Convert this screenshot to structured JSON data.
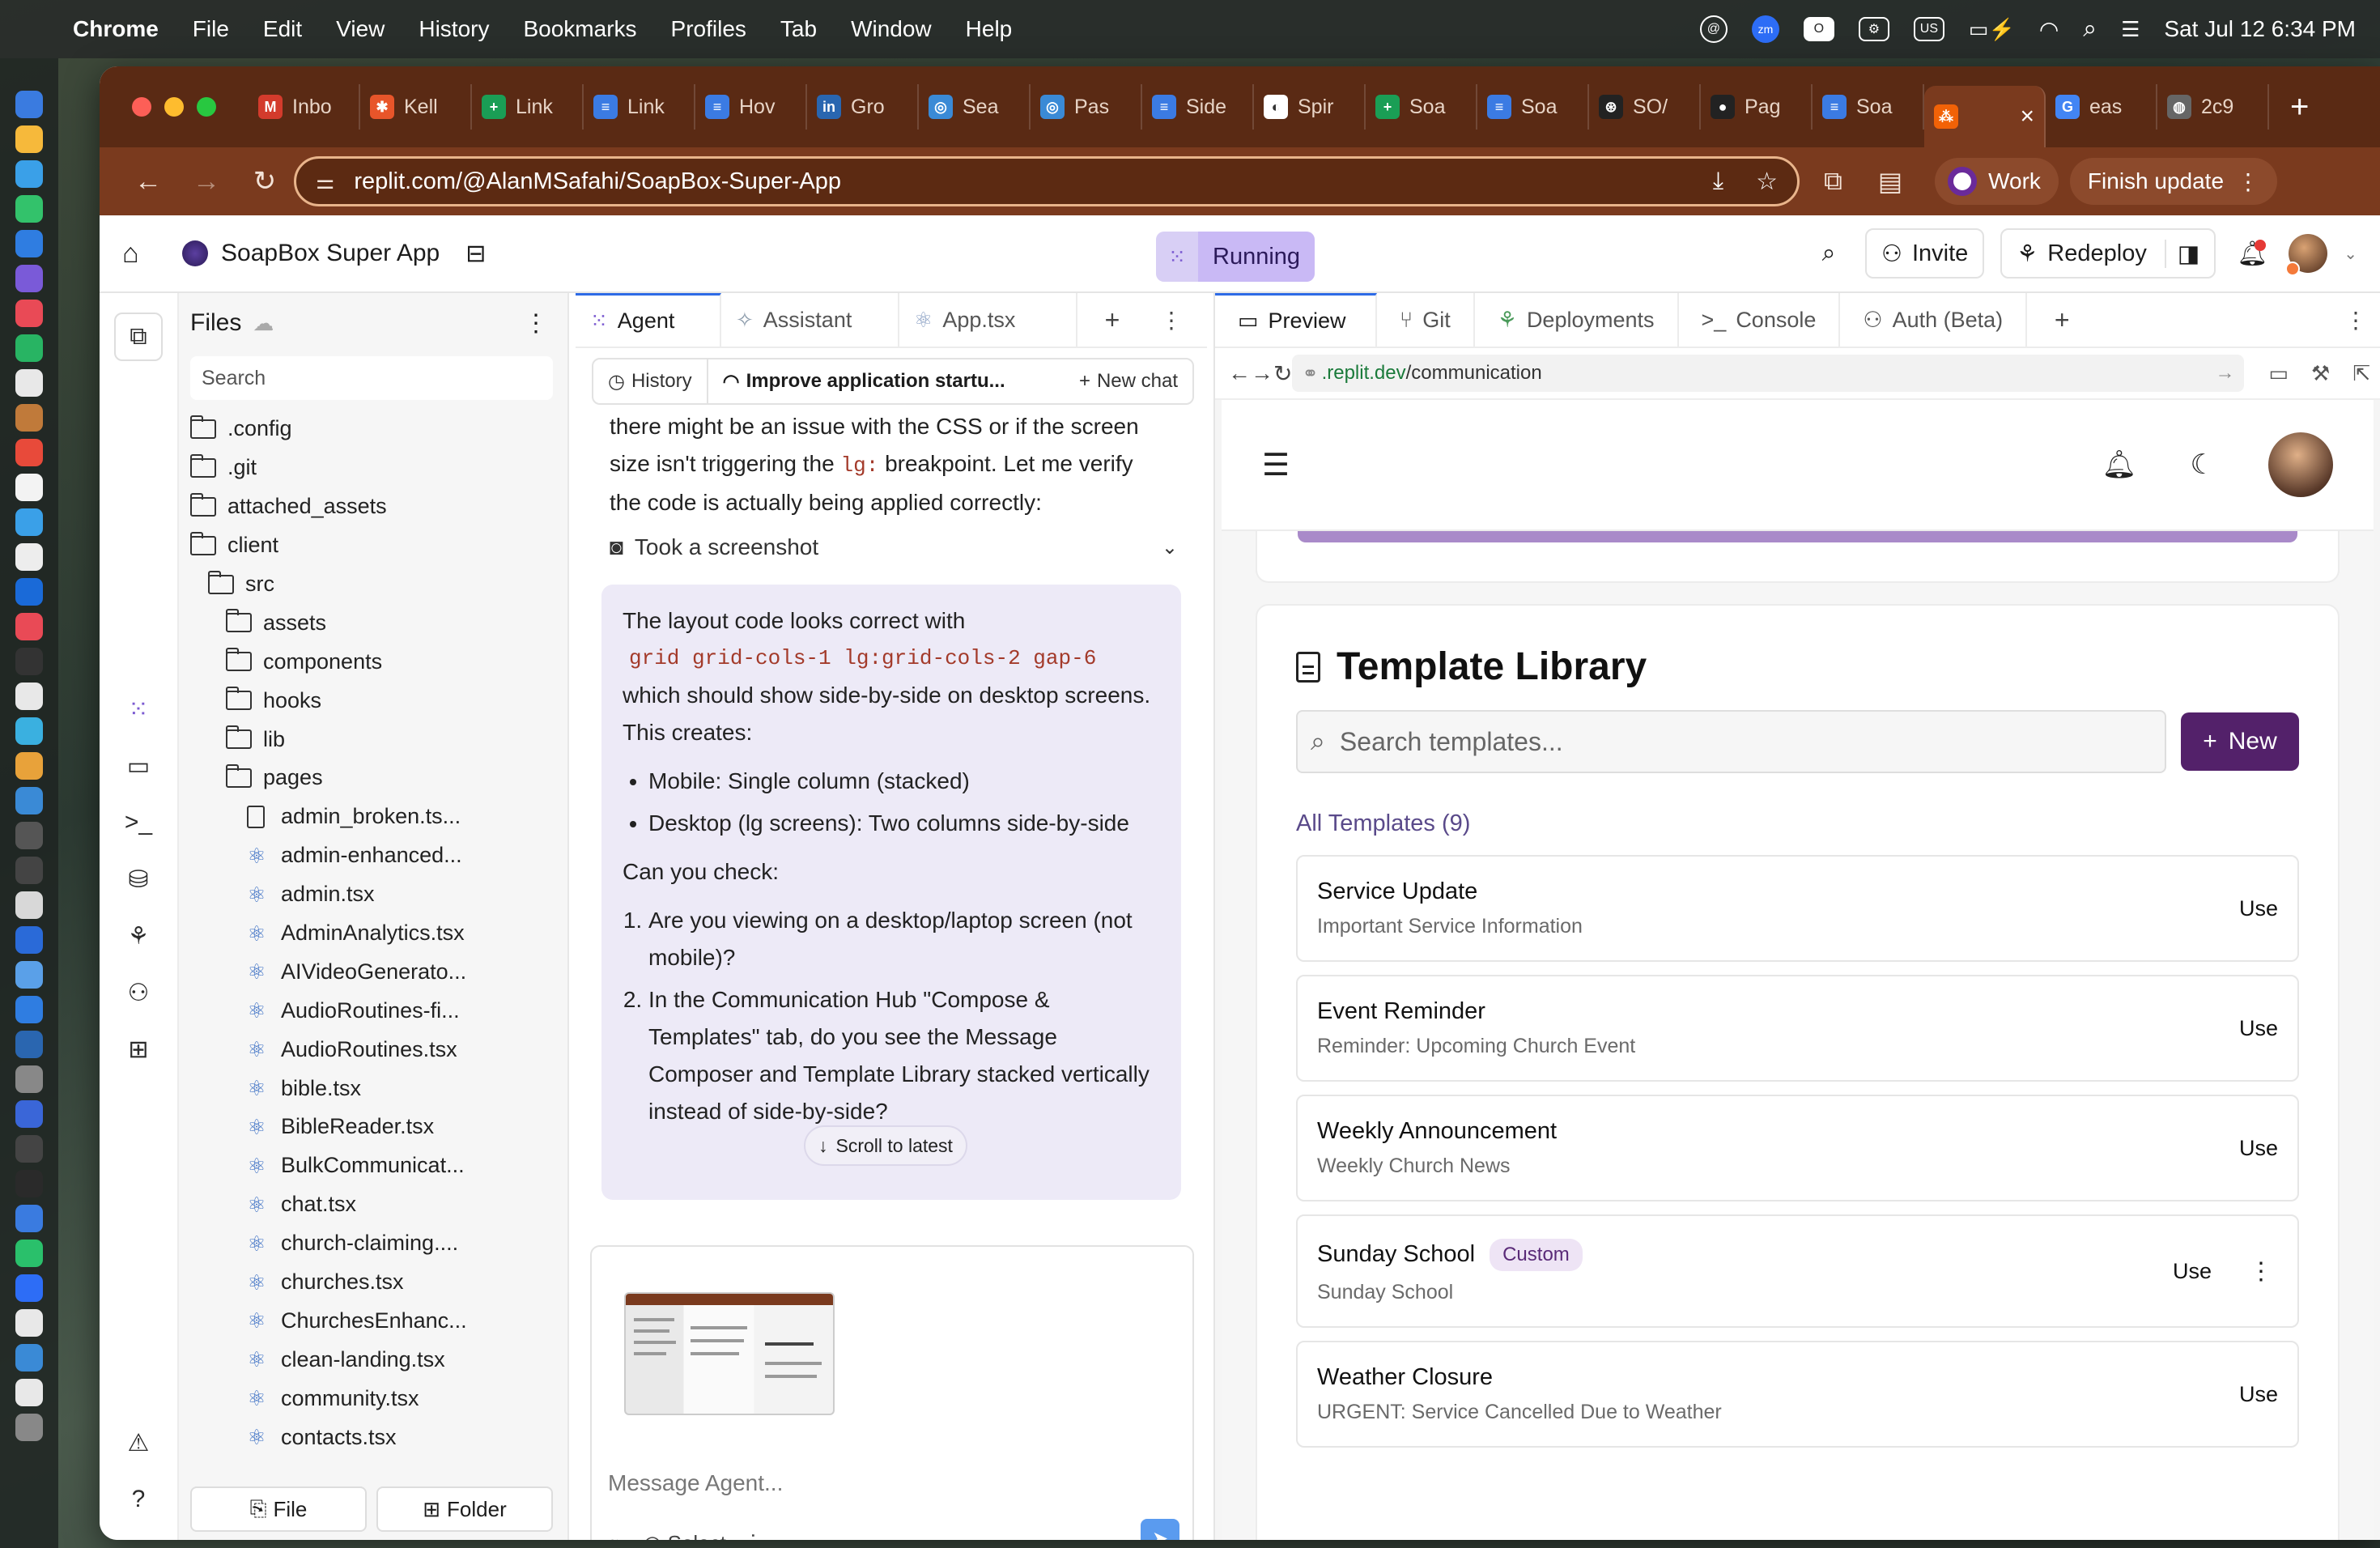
{
  "menubar": {
    "app_name": "Chrome",
    "items": [
      "File",
      "Edit",
      "View",
      "History",
      "Bookmarks",
      "Profiles",
      "Tab",
      "Window",
      "Help"
    ],
    "zoom_badge": "zm",
    "input_source": "US",
    "datetime": "Sat Jul 12  6:34 PM"
  },
  "tabs": [
    {
      "label": "Inbo",
      "fav": "M",
      "color": "#d33b2c"
    },
    {
      "label": "Kell",
      "fav": "✱",
      "color": "#e8552a"
    },
    {
      "label": "Link",
      "fav": "+",
      "color": "#1a9e55"
    },
    {
      "label": "Link",
      "fav": "≡",
      "color": "#3b7be3"
    },
    {
      "label": "Hov",
      "fav": "≡",
      "color": "#3b7be3"
    },
    {
      "label": "Gro",
      "fav": "in",
      "color": "#2966b0"
    },
    {
      "label": "Sea",
      "fav": "◎",
      "color": "#3a8ad6"
    },
    {
      "label": "Pas",
      "fav": "◎",
      "color": "#3a8ad6"
    },
    {
      "label": "Side",
      "fav": "≡",
      "color": "#3b7be3"
    },
    {
      "label": "Spir",
      "fav": "◐",
      "color": "#ffffff"
    },
    {
      "label": "Soa",
      "fav": "+",
      "color": "#1a9e55"
    },
    {
      "label": "Soa",
      "fav": "≡",
      "color": "#3b7be3"
    },
    {
      "label": "SO/",
      "fav": "⊛",
      "color": "#222222"
    },
    {
      "label": "Pag",
      "fav": "●",
      "color": "#222222"
    },
    {
      "label": "Soa",
      "fav": "≡",
      "color": "#3b7be3"
    }
  ],
  "active_tab": {
    "close": "×"
  },
  "tabs_after": [
    {
      "label": "eas",
      "fav": "G",
      "color": "#4285f4"
    },
    {
      "label": "2c9",
      "fav": "◍",
      "color": "#666666"
    }
  ],
  "omnibox": {
    "url": "replit.com/@AlanMSafahi/SoapBox-Super-App"
  },
  "profile": {
    "label": "Work"
  },
  "finish_update": {
    "label": "Finish update"
  },
  "replit": {
    "project_title": "SoapBox Super App",
    "running_label": "Running",
    "invite_label": "Invite",
    "redeploy_label": "Redeploy"
  },
  "files": {
    "title": "Files",
    "search_placeholder": "Search",
    "tree": [
      {
        "label": ".config",
        "type": "folder",
        "depth": 0
      },
      {
        "label": ".git",
        "type": "folder",
        "depth": 0
      },
      {
        "label": "attached_assets",
        "type": "folder",
        "depth": 0
      },
      {
        "label": "client",
        "type": "folder-open",
        "depth": 0
      },
      {
        "label": "src",
        "type": "folder-open",
        "depth": 1
      },
      {
        "label": "assets",
        "type": "folder",
        "depth": 2
      },
      {
        "label": "components",
        "type": "folder",
        "depth": 2
      },
      {
        "label": "hooks",
        "type": "folder",
        "depth": 2
      },
      {
        "label": "lib",
        "type": "folder",
        "depth": 2
      },
      {
        "label": "pages",
        "type": "folder-open",
        "depth": 2
      },
      {
        "label": "admin_broken.ts...",
        "type": "file",
        "depth": 3
      },
      {
        "label": "admin-enhanced...",
        "type": "react",
        "depth": 3
      },
      {
        "label": "admin.tsx",
        "type": "react",
        "depth": 3
      },
      {
        "label": "AdminAnalytics.tsx",
        "type": "react",
        "depth": 3
      },
      {
        "label": "AIVideoGenerato...",
        "type": "react",
        "depth": 3
      },
      {
        "label": "AudioRoutines-fi...",
        "type": "react",
        "depth": 3
      },
      {
        "label": "AudioRoutines.tsx",
        "type": "react",
        "depth": 3
      },
      {
        "label": "bible.tsx",
        "type": "react",
        "depth": 3
      },
      {
        "label": "BibleReader.tsx",
        "type": "react",
        "depth": 3
      },
      {
        "label": "BulkCommunicat...",
        "type": "react",
        "depth": 3
      },
      {
        "label": "chat.tsx",
        "type": "react",
        "depth": 3
      },
      {
        "label": "church-claiming....",
        "type": "react",
        "depth": 3
      },
      {
        "label": "churches.tsx",
        "type": "react",
        "depth": 3
      },
      {
        "label": "ChurchesEnhanc...",
        "type": "react",
        "depth": 3
      },
      {
        "label": "clean-landing.tsx",
        "type": "react",
        "depth": 3
      },
      {
        "label": "community.tsx",
        "type": "react",
        "depth": 3
      },
      {
        "label": "contacts.tsx",
        "type": "react",
        "depth": 3
      }
    ],
    "new_file_label": "File",
    "new_folder_label": "Folder"
  },
  "agent_tabs": [
    "Agent",
    "Assistant",
    "App.tsx"
  ],
  "agent_bar": {
    "history_label": "History",
    "thread_title": "Improve application startu...",
    "new_chat_label": "New chat"
  },
  "chat": {
    "pre_line1": "there might be an issue with the CSS or if the screen",
    "pre_line2a": "size isn't triggering the ",
    "pre_code": "lg:",
    "pre_line2b": " breakpoint. Let me verify",
    "pre_line3": "the code is actually being applied correctly:",
    "screenshot_label": "Took a screenshot",
    "bubble_intro": "The layout code looks correct with",
    "bubble_code": "grid grid-cols-1 lg:grid-cols-2 gap-6",
    "bubble_after_code": "which should show side-by-side on desktop screens. This creates:",
    "bullets": [
      "Mobile: Single column (stacked)",
      "Desktop (lg screens): Two columns side-by-side"
    ],
    "ask": "Can you check:",
    "questions": [
      "Are you viewing on a desktop/laptop screen (not mobile)?",
      "In the Communication Hub \"Compose & Templates\" tab, do you see the Message Composer and Template Library stacked vertically instead of side-by-side?"
    ],
    "scroll_latest": "Scroll to latest"
  },
  "composer": {
    "placeholder": "Message Agent...",
    "select_label": "Select"
  },
  "preview_tabs": [
    "Preview",
    "Git",
    "Deployments",
    "Console",
    "Auth (Beta)"
  ],
  "preview_url": {
    "domain": ".replit.dev",
    "path": "/communication"
  },
  "template_library": {
    "title": "Template Library",
    "search_placeholder": "Search templates...",
    "new_label": "New",
    "count_label": "All Templates (9)",
    "use_label": "Use",
    "templates": [
      {
        "name": "Service Update",
        "subtitle": "Important Service Information",
        "badge": ""
      },
      {
        "name": "Event Reminder",
        "subtitle": "Reminder: Upcoming Church Event",
        "badge": ""
      },
      {
        "name": "Weekly Announcement",
        "subtitle": "Weekly Church News",
        "badge": ""
      },
      {
        "name": "Sunday School",
        "subtitle": "Sunday School",
        "badge": "Custom"
      },
      {
        "name": "Weather Closure",
        "subtitle": "URGENT: Service Cancelled Due to Weather",
        "badge": ""
      }
    ]
  }
}
